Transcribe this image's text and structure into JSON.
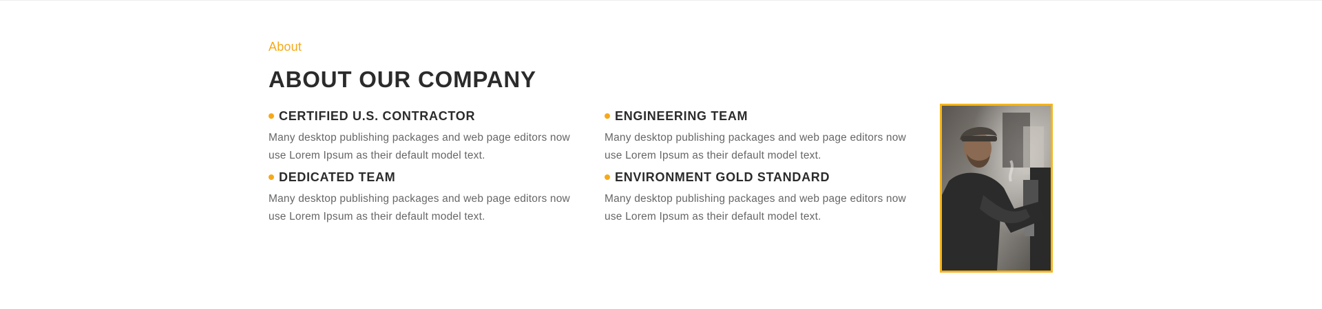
{
  "section": {
    "eyebrow": "About",
    "title": "ABOUT OUR COMPANY"
  },
  "features": [
    {
      "title": "CERTIFIED U.S. CONTRACTOR",
      "description": "Many desktop publishing packages and web page editors now use Lorem Ipsum as their default model text."
    },
    {
      "title": "ENGINEERING TEAM",
      "description": "Many desktop publishing packages and web page editors now use Lorem Ipsum as their default model text."
    },
    {
      "title": "DEDICATED TEAM",
      "description": "Many desktop publishing packages and web page editors now use Lorem Ipsum as their default model text."
    },
    {
      "title": "ENVIRONMENT GOLD STANDARD",
      "description": "Many desktop publishing packages and web page editors now use Lorem Ipsum as their default model text."
    }
  ],
  "colors": {
    "accent": "#f5a91a",
    "heading": "#2b2b2b",
    "body": "#666666"
  }
}
